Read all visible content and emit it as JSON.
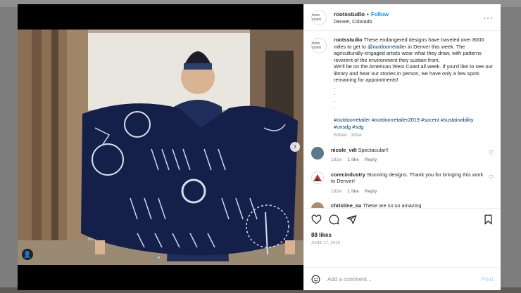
{
  "post": {
    "username": "rootsstudio",
    "separator": "•",
    "follow_label": "Follow",
    "location": "Denver, Colorado",
    "avatar_text": "roots studio",
    "caption": {
      "username": "rootsstudio",
      "text_1": " These endangered designs have traveled over 8000 miles to get to ",
      "mention": "@outdoorretailer",
      "text_2": " in Denver this week. The agriculturally-engaged artists wear what they draw, with patterns reverent of the environment they sustain from.",
      "text_3": "We'll be on the American West Coast all week. If you'd like to see our library and hear our stories in person, we have only a few spots remaining for appointments!",
      "dots": [
        ".",
        ".",
        ".",
        ".",
        "."
      ],
      "hashtags_1": "#outdoorretailer #outdoorretailer2019 #socent #sustainability",
      "hashtags_2": "#unsdg #sdg",
      "meta": "Edited · 182w"
    },
    "comments": [
      {
        "username": "nicole_vdt",
        "text": "Spectacular!!",
        "time": "181w",
        "likes": "1 like",
        "reply": "Reply",
        "avatar_color": "#5a7a8c"
      },
      {
        "username": "corecindustry",
        "text": "Stunning designs. Thank you for bringing this work to Denver!",
        "time": "182w",
        "likes": "1 like",
        "reply": "Reply",
        "avatar_color": "#c0392b"
      },
      {
        "username": "christine_su",
        "text": "These are so so amazing",
        "time": "",
        "likes": "",
        "reply": "",
        "avatar_color": "#b08a70"
      }
    ],
    "likes": "88 likes",
    "date": "JUNE 17, 2019",
    "add_comment_placeholder": "Add a comment...",
    "post_label": "Post",
    "next_glyph": "›",
    "tag_glyph": "👤"
  },
  "icons": {
    "more": "more-options-icon",
    "heart": "heart-icon",
    "comment": "comment-icon",
    "share": "share-icon",
    "save": "bookmark-icon",
    "emoji": "emoji-icon"
  }
}
